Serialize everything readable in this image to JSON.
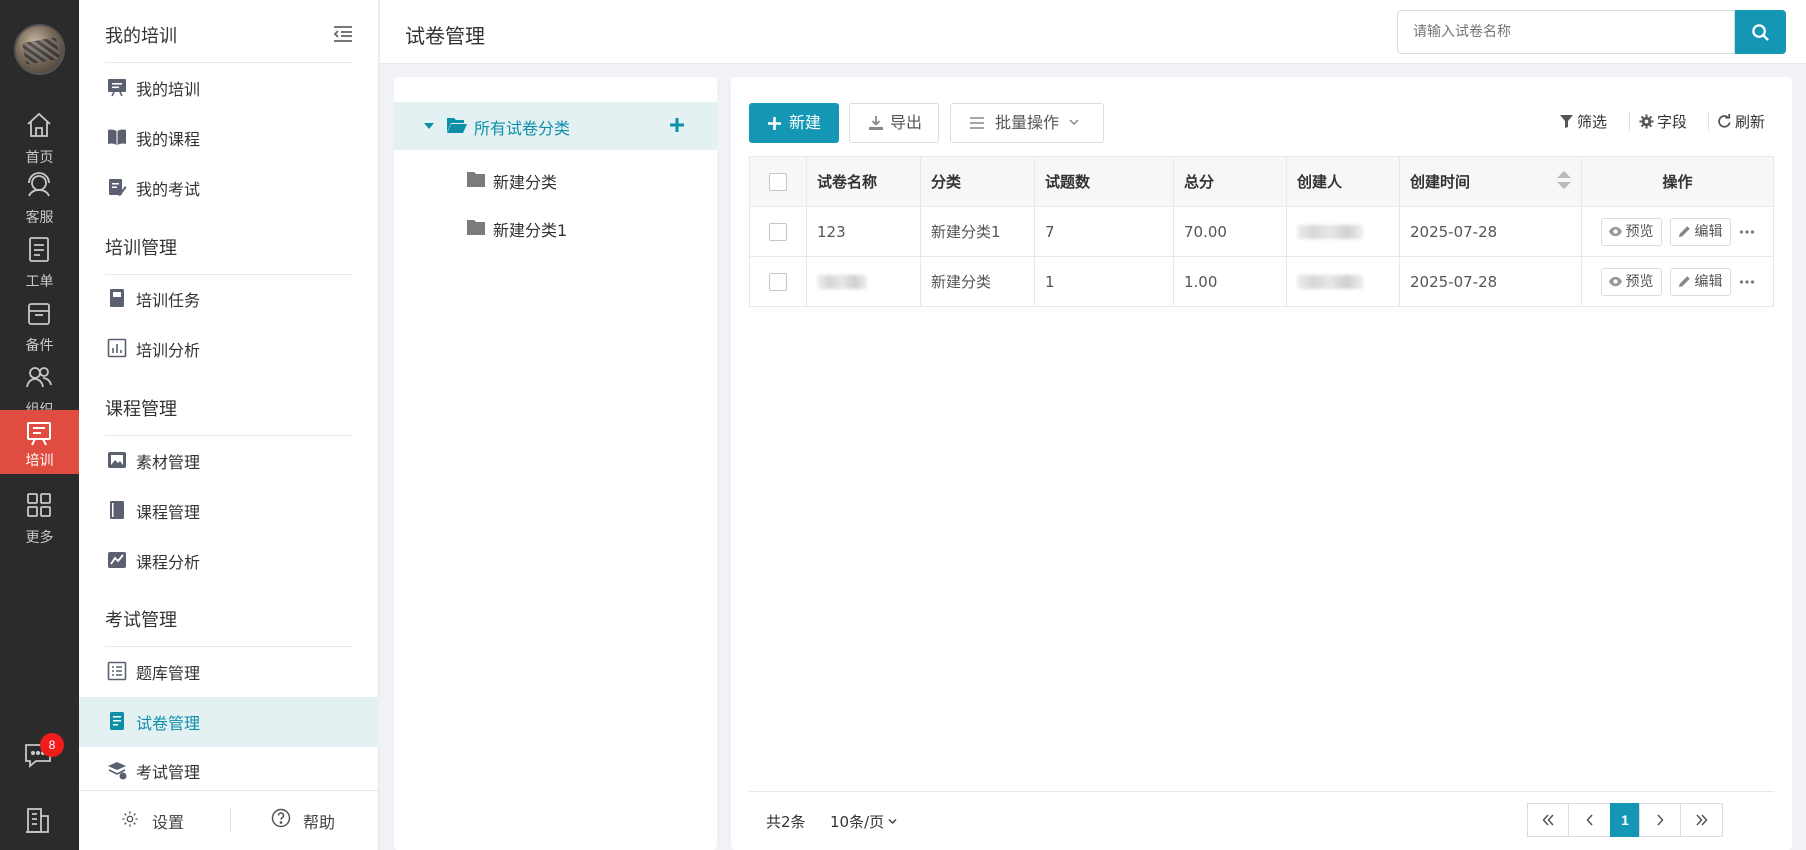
{
  "rail": {
    "items": [
      {
        "label": "首页",
        "icon": "home-icon"
      },
      {
        "label": "客服",
        "icon": "headset-icon"
      },
      {
        "label": "工单",
        "icon": "clipboard-icon"
      },
      {
        "label": "备件",
        "icon": "box-icon"
      },
      {
        "label": "组织",
        "icon": "people-icon"
      },
      {
        "label": "培训",
        "icon": "training-board-icon"
      },
      {
        "label": "更多",
        "icon": "grid-icon"
      }
    ],
    "message_badge": "8",
    "accent_color": "#e04c3f"
  },
  "menu": {
    "title": "我的培训",
    "sections": [
      {
        "heading": "",
        "items": [
          "我的培训",
          "我的课程",
          "我的考试"
        ]
      },
      {
        "heading": "培训管理",
        "items": [
          "培训任务",
          "培训分析"
        ]
      },
      {
        "heading": "课程管理",
        "items": [
          "素材管理",
          "课程管理",
          "课程分析"
        ]
      },
      {
        "heading": "考试管理",
        "items": [
          "题库管理",
          "试卷管理",
          "考试管理"
        ]
      }
    ],
    "active_item": "试卷管理",
    "settings": "设置",
    "help": "帮助"
  },
  "header": {
    "title": "试卷管理",
    "search_placeholder": "请输入试卷名称"
  },
  "categories": {
    "root": "所有试卷分类",
    "children": [
      "新建分类",
      "新建分类1"
    ]
  },
  "toolbar": {
    "new": "新建",
    "export": "导出",
    "batch": "批量操作",
    "filter": "筛选",
    "fields": "字段",
    "refresh": "刷新"
  },
  "table": {
    "columns": [
      "试卷名称",
      "分类",
      "试题数",
      "总分",
      "创建人",
      "创建时间",
      "操作"
    ],
    "rows": [
      {
        "name": "123",
        "category": "新建分类1",
        "count": "7",
        "score": "70.00",
        "creator": "",
        "created": "2025-07-28"
      },
      {
        "name": "",
        "category": "新建分类",
        "count": "1",
        "score": "1.00",
        "creator": "",
        "created": "2025-07-28"
      }
    ],
    "preview": "预览",
    "edit": "编辑"
  },
  "footer": {
    "total": "共2条",
    "page_size": "10条/页",
    "current_page": "1"
  },
  "colors": {
    "primary": "#1497b5",
    "active_bg": "#e3f1f3",
    "rail_bg": "#2b2b2b"
  }
}
